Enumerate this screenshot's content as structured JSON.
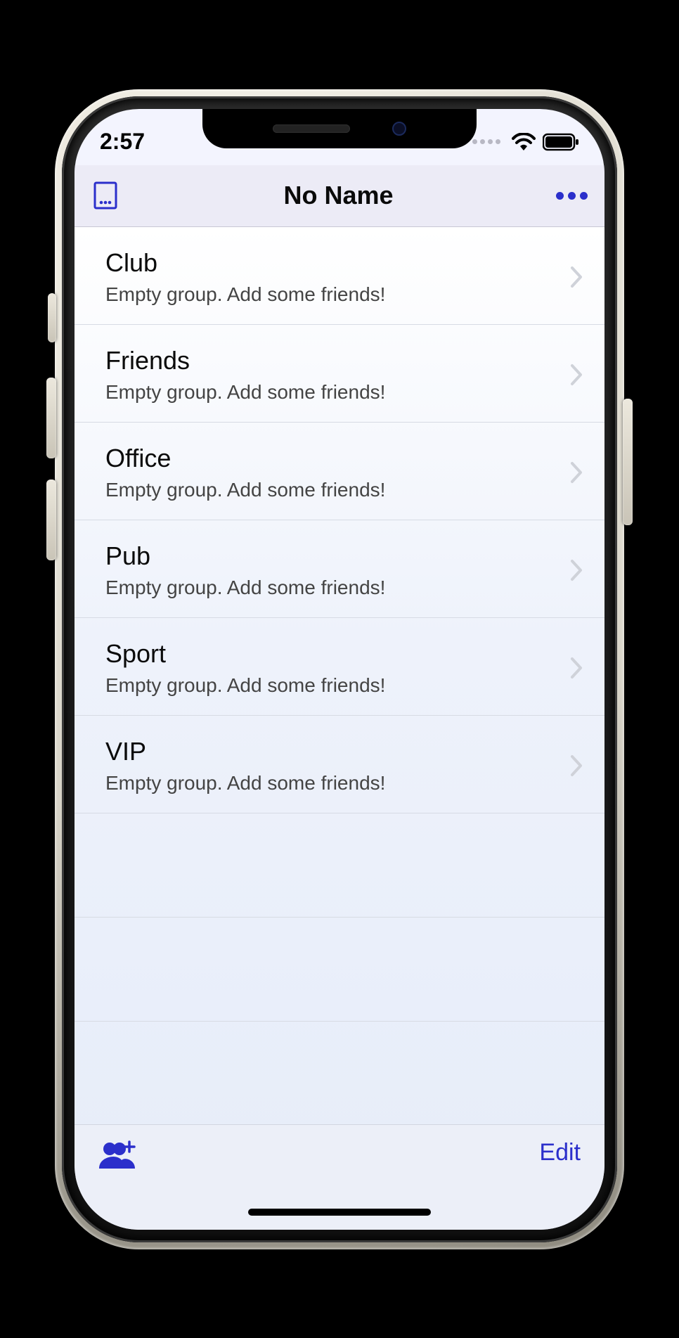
{
  "statusbar": {
    "time": "2:57"
  },
  "navbar": {
    "title": "No Name"
  },
  "groups": [
    {
      "name": "Club",
      "subtitle": "Empty group. Add some friends!"
    },
    {
      "name": "Friends",
      "subtitle": "Empty group. Add some friends!"
    },
    {
      "name": "Office",
      "subtitle": "Empty group. Add some friends!"
    },
    {
      "name": "Pub",
      "subtitle": "Empty group. Add some friends!"
    },
    {
      "name": "Sport",
      "subtitle": "Empty group. Add some friends!"
    },
    {
      "name": "VIP",
      "subtitle": "Empty group. Add some friends!"
    }
  ],
  "toolbar": {
    "edit_label": "Edit"
  },
  "colors": {
    "accent": "#2b2fcb"
  }
}
